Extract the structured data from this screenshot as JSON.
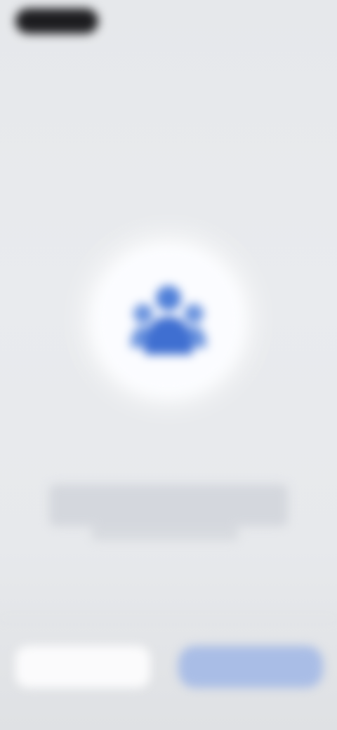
{
  "colors": {
    "accent": "#3f6fd1",
    "accent_light": "#a9bde6",
    "background": "#e8eaed",
    "headline": "#4a4d55"
  },
  "hero": {
    "icon": "person-group-icon"
  },
  "headline": {
    "line1": "",
    "line2": ""
  },
  "body": {
    "text": ""
  },
  "actions": {
    "secondary_label": "",
    "primary_label": ""
  }
}
